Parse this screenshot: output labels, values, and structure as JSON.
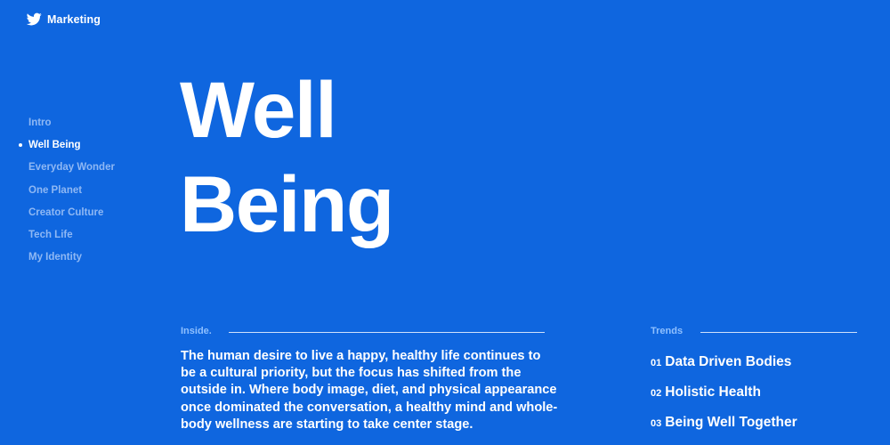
{
  "brand": {
    "icon": "twitter-bird-icon",
    "label": "Marketing"
  },
  "nav": {
    "items": [
      {
        "label": "Intro",
        "active": false
      },
      {
        "label": "Well Being",
        "active": true
      },
      {
        "label": "Everyday Wonder",
        "active": false
      },
      {
        "label": "One Planet",
        "active": false
      },
      {
        "label": "Creator Culture",
        "active": false
      },
      {
        "label": "Tech Life",
        "active": false
      },
      {
        "label": "My Identity",
        "active": false
      }
    ]
  },
  "hero": {
    "line1": "Well",
    "line2": "Being"
  },
  "inside": {
    "label": "Inside.",
    "text": "The human desire to live a happy, healthy life continues to be a cultural priority, but the focus has shifted from the outside in. Where body image, diet, and physical appearance once dominated the conversation, a healthy mind and whole-body wellness are starting to take center stage."
  },
  "trends": {
    "label": "Trends",
    "items": [
      {
        "num": "01",
        "text": "Data Driven Bodies"
      },
      {
        "num": "02",
        "text": "Holistic Health"
      },
      {
        "num": "03",
        "text": "Being Well Together"
      }
    ]
  },
  "colors": {
    "background": "#0f66df",
    "nav_inactive": "#8fb8f4",
    "section_label": "#8fc0ff",
    "text": "#ffffff"
  }
}
